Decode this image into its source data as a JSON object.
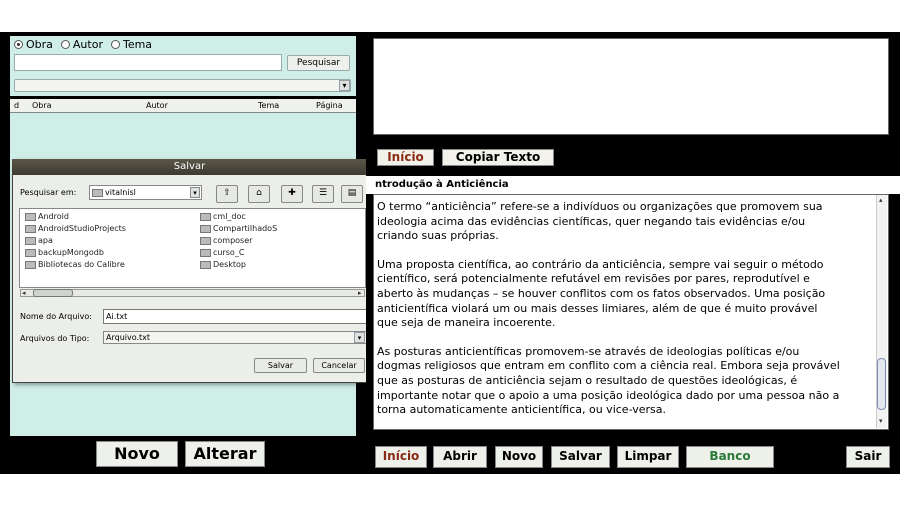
{
  "search": {
    "radio_obra": "Obra",
    "radio_autor": "Autor",
    "radio_tema": "Tema",
    "search_button": "Pesquisar",
    "search_value": "",
    "combo_value": ""
  },
  "results_table": {
    "columns": [
      "d",
      "Obra",
      "Autor",
      "Tema",
      "Página"
    ]
  },
  "left_buttons": {
    "novo": "Novo",
    "alterar": "Alterar"
  },
  "dialog": {
    "title": "Salvar",
    "look_in_label": "Pesquisar em:",
    "look_in_value": "vitalnisl",
    "files_col1": [
      "Android",
      "AndroidStudioProjects",
      "apa",
      "backupMongodb",
      "Bibliotecas do Calibre"
    ],
    "files_col2": [
      "cml_doc",
      "CompartilhadoS",
      "composer",
      "curso_C",
      "Desktop"
    ],
    "file_name_label": "Nome do Arquivo:",
    "file_name_value": "Ai.txt",
    "file_type_label": "Arquivos do Tipo:",
    "file_type_value": "Arquivo.txt",
    "save_button": "Salvar",
    "cancel_button": "Cancelar"
  },
  "right": {
    "tab_inicio": "Início",
    "tab_copiar": "Copiar Texto",
    "text_title": "ntrodução à Anticiência",
    "paragraph1": "O termo “anticiência” refere-se a indivíduos ou organizações que promovem sua\nideologia acima das evidências científicas, quer negando tais evidências e/ou\ncriando suas próprias.",
    "paragraph2": "Uma proposta científica, ao contrário da anticiência, sempre vai seguir o método\ncientífico, será potencialmente refutável em revisões por pares, reprodutível e\naberto às mudanças – se houver conflitos com os fatos observados. Uma posição\nanticientífica violará um ou mais desses limiares, além de que é muito provável\nque seja de maneira incoerente.",
    "paragraph3": "As posturas anticientíficas promovem-se através de ideologias políticas e/ou\ndogmas religiosos que entram em conflito com a ciência real. Embora seja provável\nque as posturas de anticiência sejam o resultado de questões ideológicas, é\nimportante notar que o apoio a uma posição ideológica dado por uma pessoa não a\ntorna automaticamente anticientífica, ou vice-versa."
  },
  "bottom_buttons": {
    "inicio": "Início",
    "abrir": "Abrir",
    "novo": "Novo",
    "salvar": "Salvar",
    "limpar": "Limpar",
    "banco": "Banco",
    "sair": "Sair"
  },
  "colors": {
    "panel_bg": "#000000",
    "mint": "#cfeee8",
    "accent_red": "#8a2a14",
    "banco_green": "#2a7a3a"
  }
}
